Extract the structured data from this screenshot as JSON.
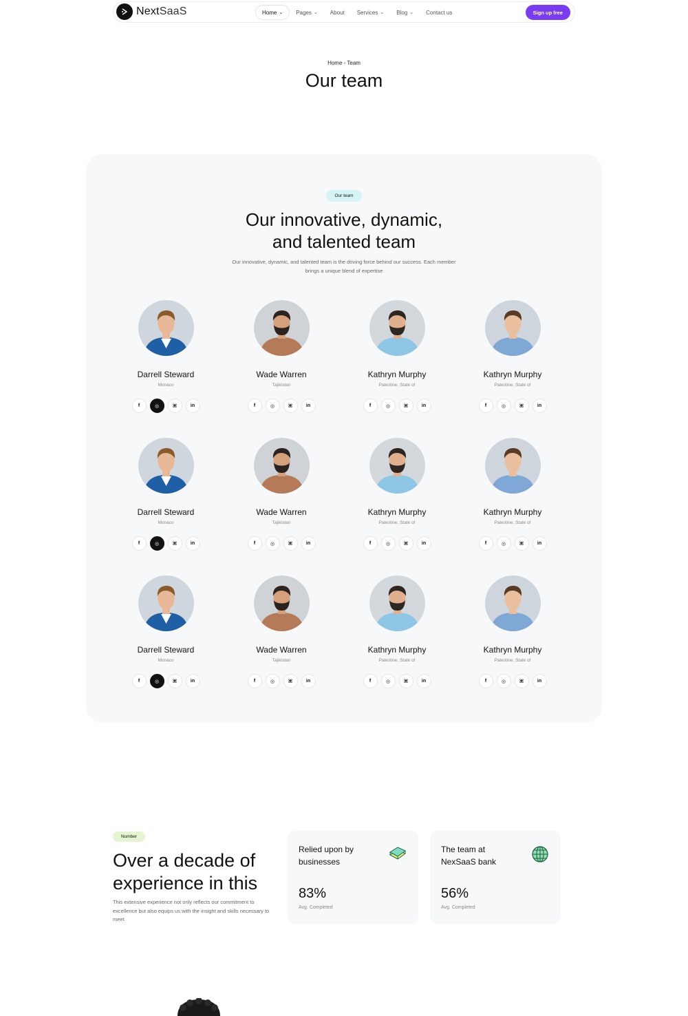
{
  "nav": {
    "logo_main": "Next",
    "logo_sub": "SaaS",
    "items": [
      {
        "label": "Home",
        "has_chevron": true,
        "active": true
      },
      {
        "label": "Pages",
        "has_chevron": true,
        "active": false
      },
      {
        "label": "About",
        "has_chevron": false,
        "active": false
      },
      {
        "label": "Services",
        "has_chevron": true,
        "active": false
      },
      {
        "label": "Blog",
        "has_chevron": true,
        "active": false
      },
      {
        "label": "Contact us",
        "has_chevron": false,
        "active": false
      }
    ],
    "signup_label": "Sign up free",
    "signup_color": "#7a3cf0"
  },
  "hero": {
    "breadcrumb": "Home - Team",
    "title": "Our team"
  },
  "team": {
    "badge": "Our team",
    "heading_line1": "Our innovative, dynamic,",
    "heading_line2": "and talented team",
    "description": "Our innovative, dynamic, and talented team is the driving force behind our success. Each member brings a unique blend of expertise",
    "members": [
      {
        "name": "Darrell Steward",
        "location": "Monaco"
      },
      {
        "name": "Wade Warren",
        "location": "Tajikistan"
      },
      {
        "name": "Kathryn Murphy",
        "location": "Palestine, State of"
      },
      {
        "name": "Kathryn Murphy",
        "location": "Palestine, State of"
      },
      {
        "name": "Darrell Steward",
        "location": "Monaco"
      },
      {
        "name": "Wade Warren",
        "location": "Tajikistan"
      },
      {
        "name": "Kathryn Murphy",
        "location": "Palestine, State of"
      },
      {
        "name": "Kathryn Murphy",
        "location": "Palestine, State of"
      },
      {
        "name": "Darrell Steward",
        "location": "Monaco"
      },
      {
        "name": "Wade Warren",
        "location": "Tajikistan"
      },
      {
        "name": "Kathryn Murphy",
        "location": "Palestine, State of"
      },
      {
        "name": "Kathryn Murphy",
        "location": "Palestine, State of"
      }
    ],
    "social_icons": [
      "facebook-icon",
      "dribbble-icon",
      "github-icon",
      "linkedin-icon"
    ]
  },
  "numbers": {
    "badge": "Number",
    "title": "Over a decade of experience in this",
    "description": "This extensive experience not only reflects our commitment to excellence but also equips us with the insight and skills necessary to meet",
    "stats": [
      {
        "label": "Relied upon by businesses",
        "value": "83%",
        "caption": "Avg. Completed",
        "icon": "stack-icon"
      },
      {
        "label": "The team at NexSaaS bank",
        "value": "56%",
        "caption": "Avg. Completed",
        "icon": "globe-icon"
      }
    ]
  }
}
